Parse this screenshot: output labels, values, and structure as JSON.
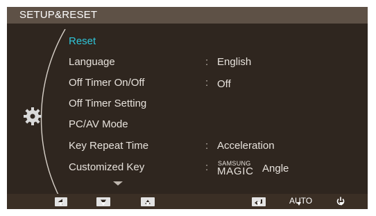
{
  "header": {
    "title": "SETUP&RESET"
  },
  "menu": {
    "items": [
      {
        "label": "Reset",
        "active": true
      },
      {
        "label": "Language",
        "value": "English"
      },
      {
        "label": "Off Timer On/Off",
        "value": "Off"
      },
      {
        "label": "Off Timer Setting"
      },
      {
        "label": "PC/AV Mode"
      },
      {
        "label": "Key Repeat Time",
        "value": "Acceleration"
      },
      {
        "label": "Customized Key",
        "value_brand_small": "SAMSUNG",
        "value_brand": "MAGIC",
        "value_suffix": "Angle"
      }
    ],
    "colon": ":"
  },
  "bottom_bar": {
    "buttons": [
      {
        "name": "left",
        "icon": "arrow-left-icon"
      },
      {
        "name": "down",
        "icon": "arrow-down-icon"
      },
      {
        "name": "up",
        "icon": "arrow-up-icon"
      },
      {
        "name": "enter",
        "icon": "enter-icon"
      },
      {
        "name": "auto",
        "label": "AUTO"
      },
      {
        "name": "power",
        "icon": "power-icon"
      }
    ]
  },
  "colors": {
    "accent": "#2fc6da",
    "panel": "#2f261f",
    "title_bar": "#5e5146",
    "text": "#e7e2dc"
  }
}
